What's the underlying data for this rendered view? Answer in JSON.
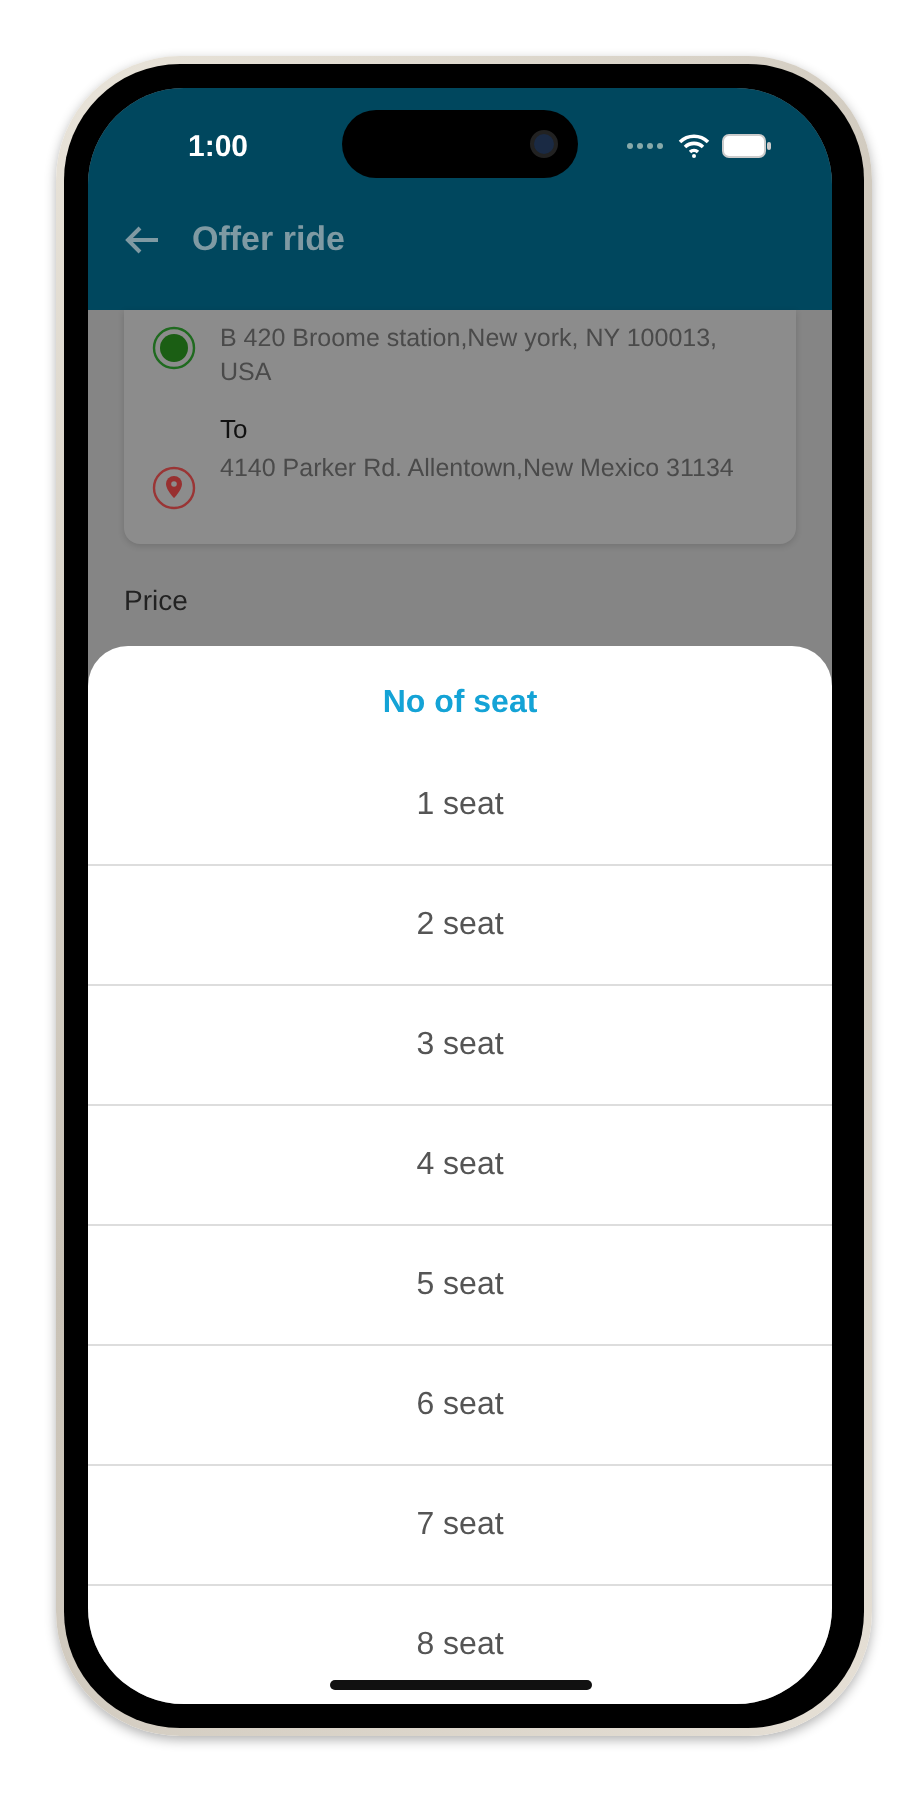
{
  "status_bar": {
    "time": "1:00"
  },
  "header": {
    "title": "Offer ride"
  },
  "route": [
    {
      "kind": "origin",
      "address": "B 420 Broome station,New york, NY 100013, USA"
    },
    {
      "kind": "destination",
      "label": "To",
      "address": "4140 Parker Rd. Allentown,New Mexico 31134"
    }
  ],
  "price": {
    "label": "Price"
  },
  "sheet": {
    "title": "No of seat",
    "options": [
      "1 seat",
      "2 seat",
      "3 seat",
      "4 seat",
      "5 seat",
      "6 seat",
      "7 seat",
      "8 seat"
    ]
  }
}
